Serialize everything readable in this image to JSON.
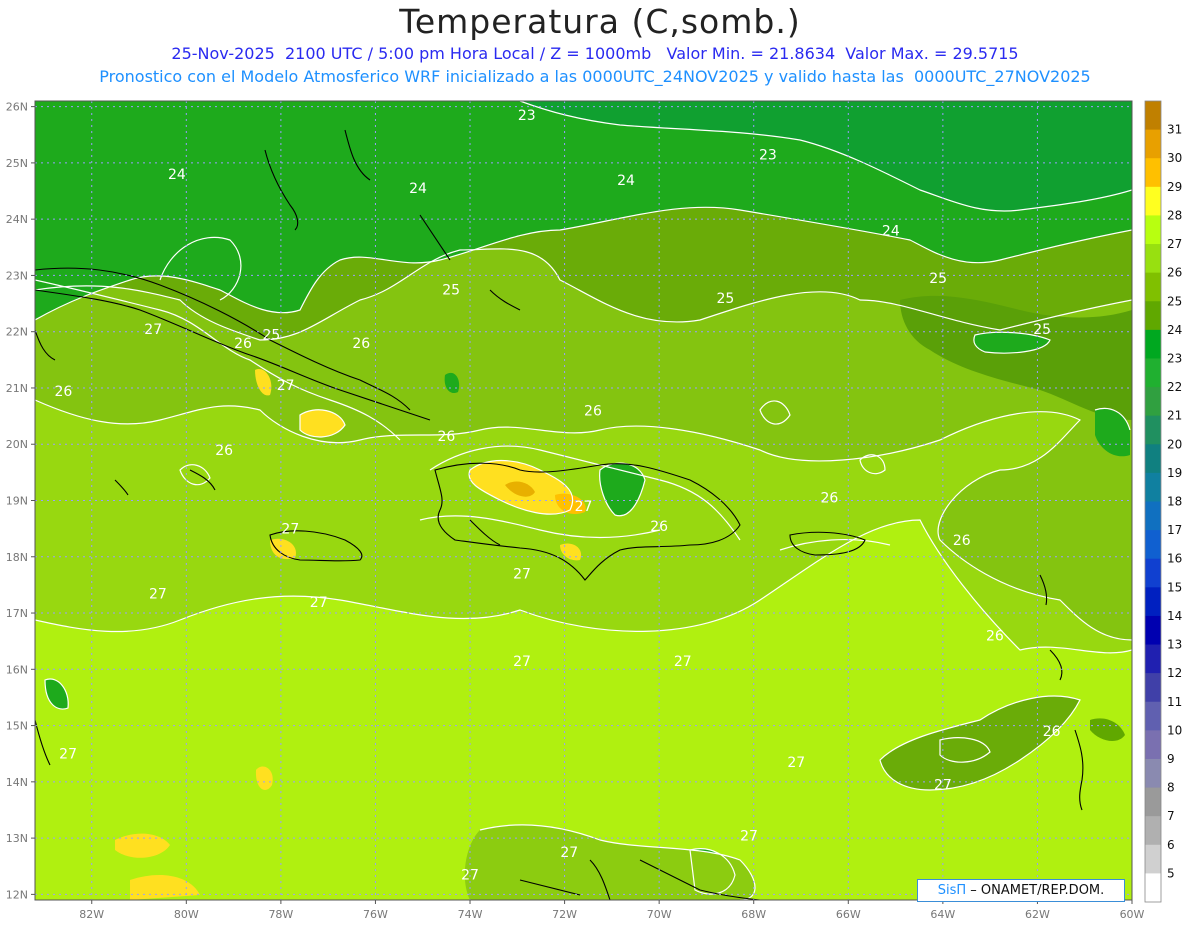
{
  "header": {
    "title": "Temperatura (C,somb.)",
    "line1": "25-Nov-2025  2100 UTC / 5:00 pm Hora Local / Z = 1000mb   Valor Min. = 21.8634  Valor Max. = 29.5715",
    "line2": "Pronostico con el Modelo Atmosferico WRF inicializado a las 0000UTC_24NOV2025 y valido hasta las  0000UTC_27NOV2025"
  },
  "map": {
    "lat_ticks": [
      "26N",
      "25N",
      "24N",
      "23N",
      "22N",
      "21N",
      "20N",
      "19N",
      "18N",
      "17N",
      "16N",
      "15N",
      "14N",
      "13N",
      "12N"
    ],
    "lon_ticks": [
      "82W",
      "80W",
      "78W",
      "76W",
      "74W",
      "72W",
      "70W",
      "68W",
      "66W",
      "64W",
      "62W",
      "60W"
    ],
    "contour_labels": [
      {
        "text": "23",
        "lon": -72.8,
        "lat": 25.85
      },
      {
        "text": "23",
        "lon": -67.7,
        "lat": 25.15
      },
      {
        "text": "24",
        "lon": -80.2,
        "lat": 24.8
      },
      {
        "text": "24",
        "lon": -75.1,
        "lat": 24.55
      },
      {
        "text": "24",
        "lon": -70.7,
        "lat": 24.7
      },
      {
        "text": "24",
        "lon": -65.1,
        "lat": 23.8
      },
      {
        "text": "25",
        "lon": -74.4,
        "lat": 22.75
      },
      {
        "text": "25",
        "lon": -68.6,
        "lat": 22.6
      },
      {
        "text": "25",
        "lon": -64.1,
        "lat": 22.95
      },
      {
        "text": "25",
        "lon": -61.9,
        "lat": 22.05
      },
      {
        "text": "25",
        "lon": -78.2,
        "lat": 21.95
      },
      {
        "text": "26",
        "lon": -78.8,
        "lat": 21.8
      },
      {
        "text": "26",
        "lon": -76.3,
        "lat": 21.8
      },
      {
        "text": "26",
        "lon": -82.6,
        "lat": 20.95
      },
      {
        "text": "26",
        "lon": -71.4,
        "lat": 20.6
      },
      {
        "text": "26",
        "lon": -74.5,
        "lat": 20.15
      },
      {
        "text": "26",
        "lon": -79.2,
        "lat": 19.9
      },
      {
        "text": "26",
        "lon": -66.4,
        "lat": 19.05
      },
      {
        "text": "26",
        "lon": -63.6,
        "lat": 18.3
      },
      {
        "text": "26",
        "lon": -70.0,
        "lat": 18.55
      },
      {
        "text": "26",
        "lon": -62.9,
        "lat": 16.6
      },
      {
        "text": "26",
        "lon": -61.7,
        "lat": 14.9
      },
      {
        "text": "27",
        "lon": -80.7,
        "lat": 22.05
      },
      {
        "text": "27",
        "lon": -77.9,
        "lat": 21.05
      },
      {
        "text": "27",
        "lon": -77.8,
        "lat": 18.5
      },
      {
        "text": "27",
        "lon": -71.6,
        "lat": 18.9
      },
      {
        "text": "27",
        "lon": -72.9,
        "lat": 17.7
      },
      {
        "text": "27",
        "lon": -80.6,
        "lat": 17.35
      },
      {
        "text": "27",
        "lon": -77.2,
        "lat": 17.2
      },
      {
        "text": "27",
        "lon": -72.9,
        "lat": 16.15
      },
      {
        "text": "27",
        "lon": -69.5,
        "lat": 16.15
      },
      {
        "text": "27",
        "lon": -82.5,
        "lat": 14.5
      },
      {
        "text": "27",
        "lon": -67.1,
        "lat": 14.35
      },
      {
        "text": "27",
        "lon": -64.0,
        "lat": 13.95
      },
      {
        "text": "27",
        "lon": -68.1,
        "lat": 13.05
      },
      {
        "text": "27",
        "lon": -71.9,
        "lat": 12.75
      },
      {
        "text": "27",
        "lon": -74.0,
        "lat": 12.35
      }
    ]
  },
  "colorbar": {
    "labels": [
      "31",
      "30",
      "29",
      "28",
      "27",
      "26",
      "25",
      "24",
      "23",
      "22",
      "21",
      "20",
      "19",
      "18",
      "17",
      "16",
      "15",
      "14",
      "13",
      "12",
      "11",
      "10",
      "9",
      "8",
      "7",
      "6",
      "5"
    ],
    "colors": [
      "#c08000",
      "#e8a000",
      "#ffc000",
      "#ffff20",
      "#b8ff10",
      "#98e010",
      "#80c000",
      "#60a800",
      "#00a820",
      "#20b030",
      "#30a040",
      "#209060",
      "#108080",
      "#1080a0",
      "#1070c0",
      "#1060d0",
      "#1040d0",
      "#0020c0",
      "#0000b0",
      "#2020b0",
      "#4040a8",
      "#6060b0",
      "#7a70b0",
      "#8a8ab0",
      "#9a9a9a",
      "#b0b0b0",
      "#d0d0d0",
      "#ffffff"
    ]
  },
  "credit": {
    "brand": "SisΠ",
    "text": " – ONAMET/REP.DOM."
  }
}
